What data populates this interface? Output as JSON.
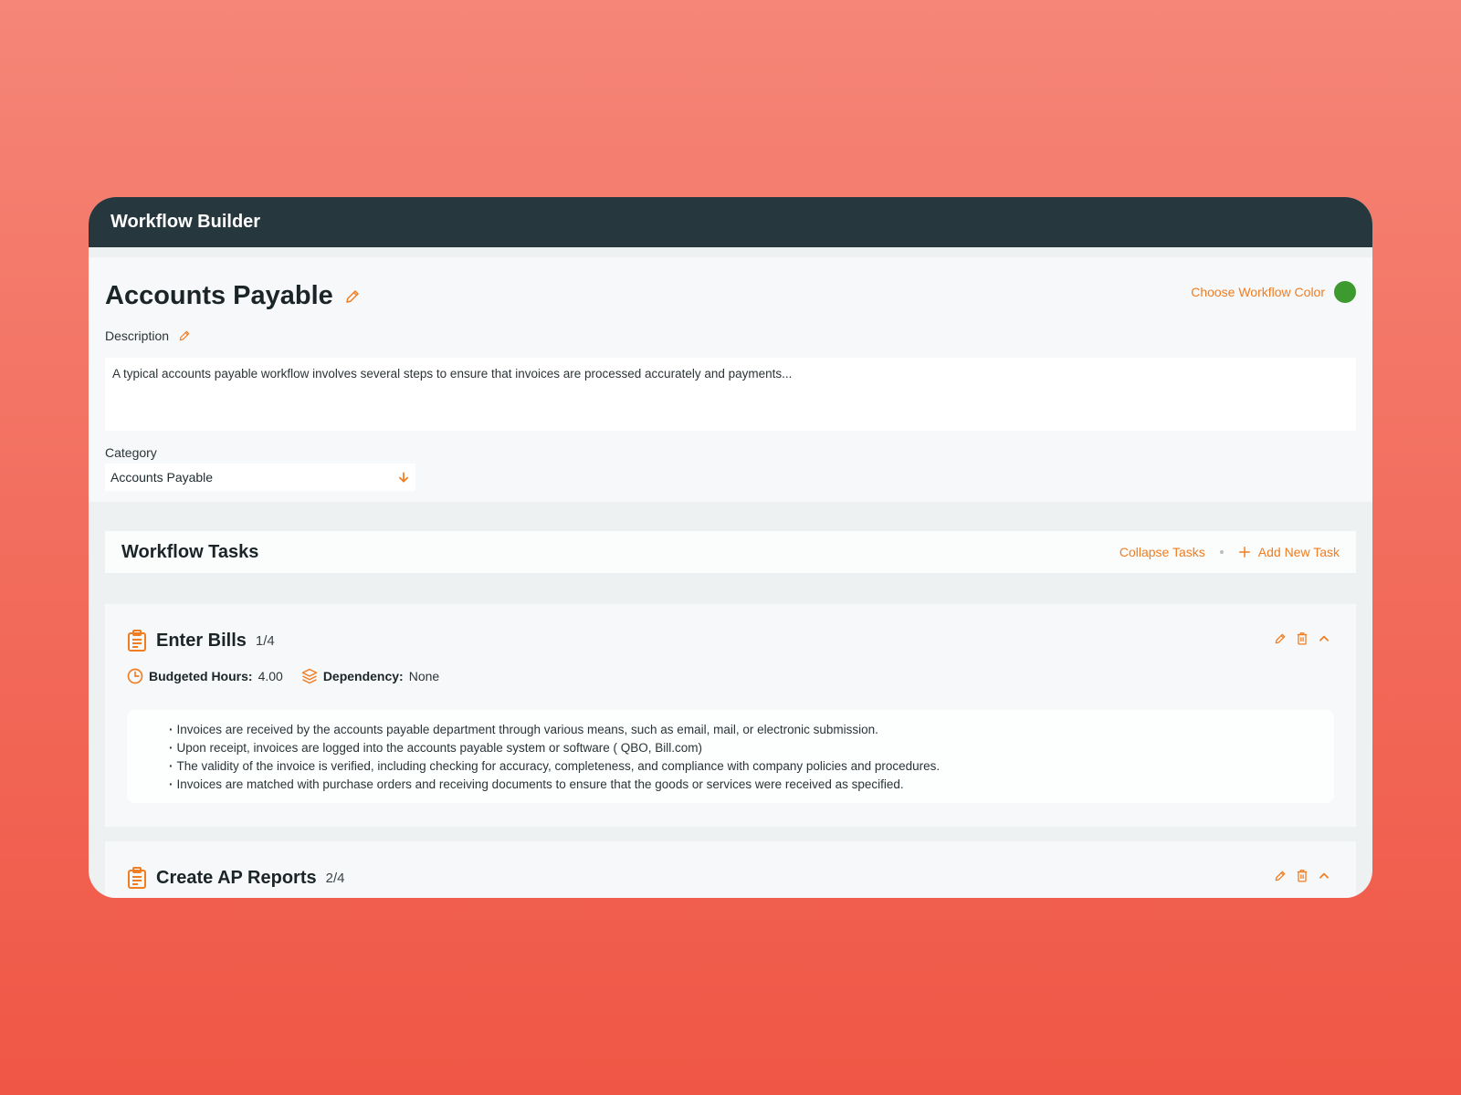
{
  "app": {
    "title": "Workflow Builder"
  },
  "workflow": {
    "name": "Accounts Payable",
    "color_label": "Choose Workflow Color",
    "color": "#3c9a2f",
    "accent": "#f07d22",
    "description_label": "Description",
    "description": "A typical accounts payable workflow involves several steps to ensure that invoices are processed accurately and payments...",
    "category_label": "Category",
    "category_value": "Accounts Payable"
  },
  "tasks_section": {
    "title": "Workflow Tasks",
    "collapse_label": "Collapse Tasks",
    "add_label": "Add New Task"
  },
  "tasks": [
    {
      "name": "Enter Bills",
      "count": "1/4",
      "hours_label": "Budgeted Hours:",
      "hours_value": "4.00",
      "dependency_label": "Dependency:",
      "dependency_value": "None",
      "items": [
        "Invoices are received by the accounts payable department through various means, such as email, mail, or electronic submission.",
        "Upon receipt, invoices are logged into the accounts payable system or software ( QBO, Bill.com)",
        "The validity of the invoice is verified, including checking for accuracy, completeness, and compliance with company policies and procedures.",
        "Invoices are matched with purchase orders and receiving documents to ensure that the goods or services were received as specified."
      ]
    },
    {
      "name": "Create AP Reports",
      "count": "2/4"
    }
  ],
  "icons": {
    "edit": "pencil-icon",
    "delete": "trash-icon",
    "collapse": "chevron-up-icon",
    "task": "clipboard-icon",
    "hours": "clock-icon",
    "dependency": "layers-icon",
    "dropdown": "arrow-down-icon",
    "add": "plus-icon"
  }
}
